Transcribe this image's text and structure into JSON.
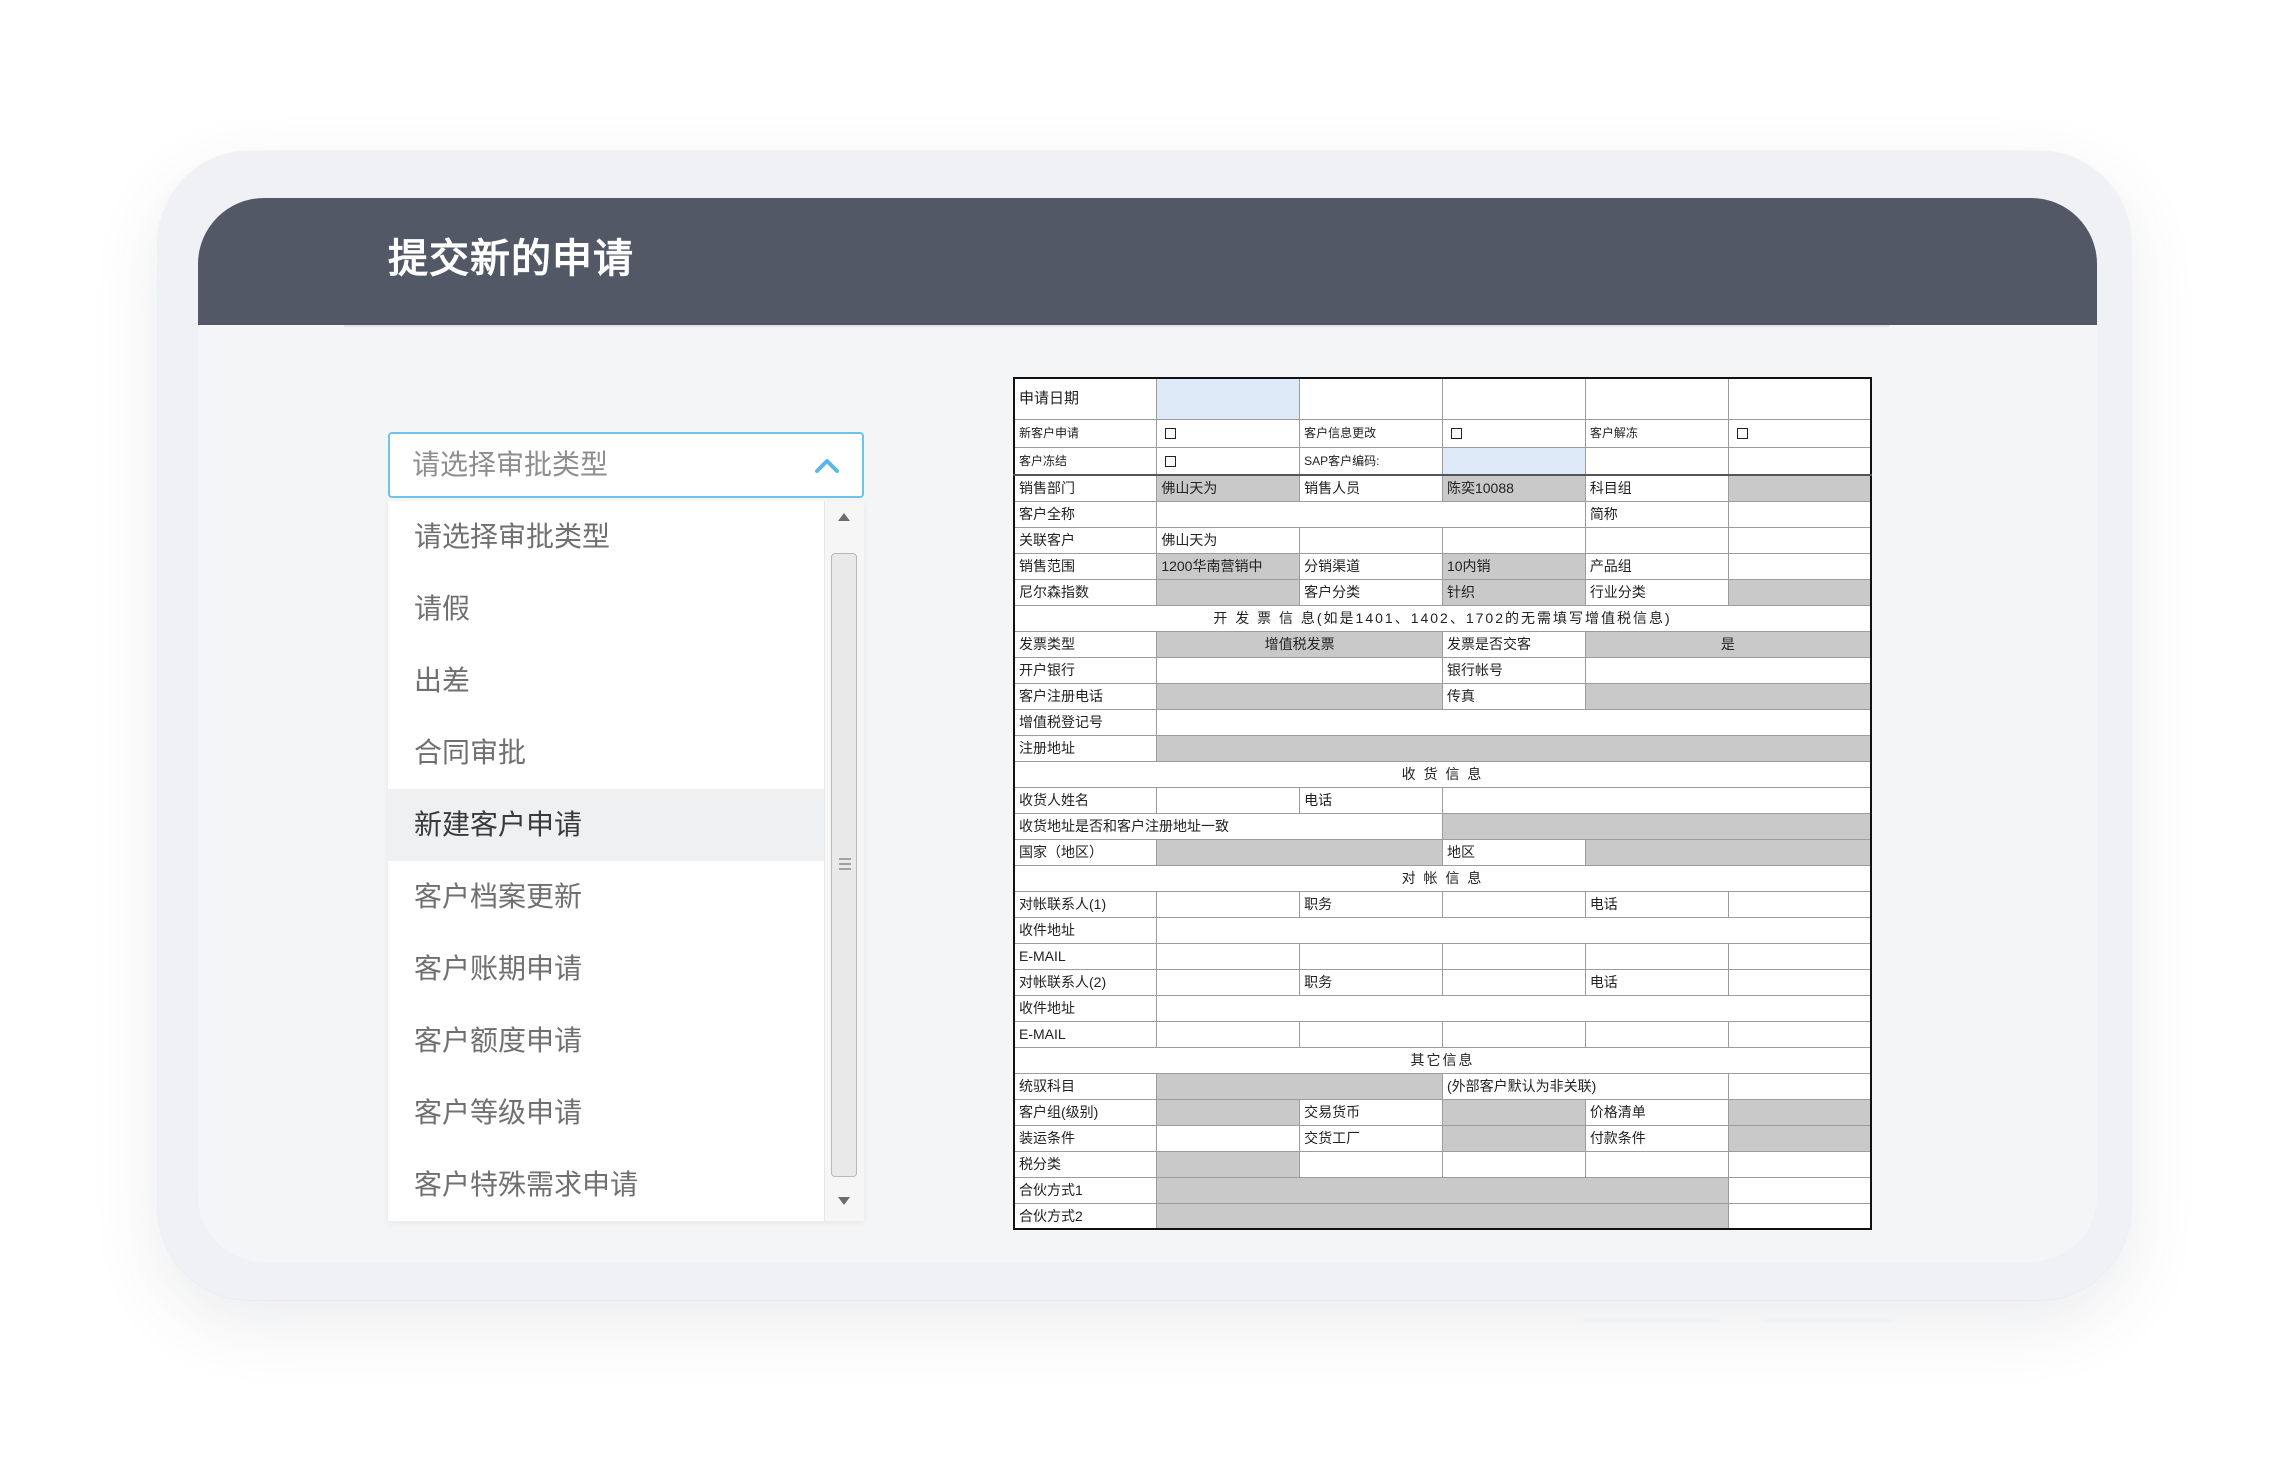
{
  "header": {
    "title": "提交新的申请"
  },
  "approval_select": {
    "value": "请选择审批类型",
    "icon": "chevron-up-icon",
    "options": [
      "请选择审批类型",
      "请假",
      "出差",
      "合同审批",
      "新建客户申请",
      "客户档案更新",
      "客户账期申请",
      "客户额度申请",
      "客户等级申请",
      "客户特殊需求申请"
    ],
    "highlighted_index": 4
  },
  "scrollbar": {
    "up_icon": "scroll-up-arrow-icon",
    "down_icon": "scroll-down-arrow-icon",
    "grip_icon": "scroll-grip-icon"
  },
  "form": {
    "checkbox_icon": "checkbox-icon",
    "rows": [
      [
        "申请日期"
      ],
      [
        "新客户申请",
        "客户信息更改",
        "客户解冻"
      ],
      [
        "客户冻结",
        "SAP客户编码:"
      ],
      [
        "销售部门",
        "佛山天为",
        "销售人员",
        "陈奕10088",
        "科目组"
      ],
      [
        "客户全称",
        "简称"
      ],
      [
        "关联客户",
        "佛山天为"
      ],
      [
        "销售范围",
        "1200华南营销中",
        "分销渠道",
        "10内销",
        "产品组"
      ],
      [
        "尼尔森指数",
        "客户分类",
        "针织",
        "行业分类"
      ],
      [
        "开 发 票 信 息(如是1401、1402、1702的无需填写增值税信息)"
      ],
      [
        "发票类型",
        "增值税发票",
        "发票是否交客",
        "是"
      ],
      [
        "开户银行",
        "银行帐号"
      ],
      [
        "客户注册电话",
        "传真"
      ],
      [
        "增值税登记号"
      ],
      [
        "注册地址"
      ],
      [
        "收 货 信 息"
      ],
      [
        "收货人姓名",
        "电话"
      ],
      [
        "收货地址是否和客户注册地址一致"
      ],
      [
        "国家（地区）",
        "地区"
      ],
      [
        "对 帐 信 息"
      ],
      [
        "对帐联系人(1)",
        "职务",
        "电话"
      ],
      [
        "收件地址"
      ],
      [
        "E-MAIL"
      ],
      [
        "对帐联系人(2)",
        "职务",
        "电话"
      ],
      [
        "收件地址"
      ],
      [
        "E-MAIL"
      ],
      [
        "其它信息"
      ],
      [
        "统驭科目",
        "(外部客户默认为非关联)"
      ],
      [
        "客户组(级别)",
        "交易货币",
        "价格清单"
      ],
      [
        "装运条件",
        "交货工厂",
        "付款条件"
      ],
      [
        "税分类"
      ],
      [
        "合伙方式1"
      ],
      [
        "合伙方式2"
      ]
    ]
  },
  "colors": {
    "header_bg": "#525866",
    "select_border": "#6ec3ea",
    "highlight_bg": "#eff0f2",
    "form_gray": "#c9c9c9",
    "form_blue": "#dde9f6"
  }
}
